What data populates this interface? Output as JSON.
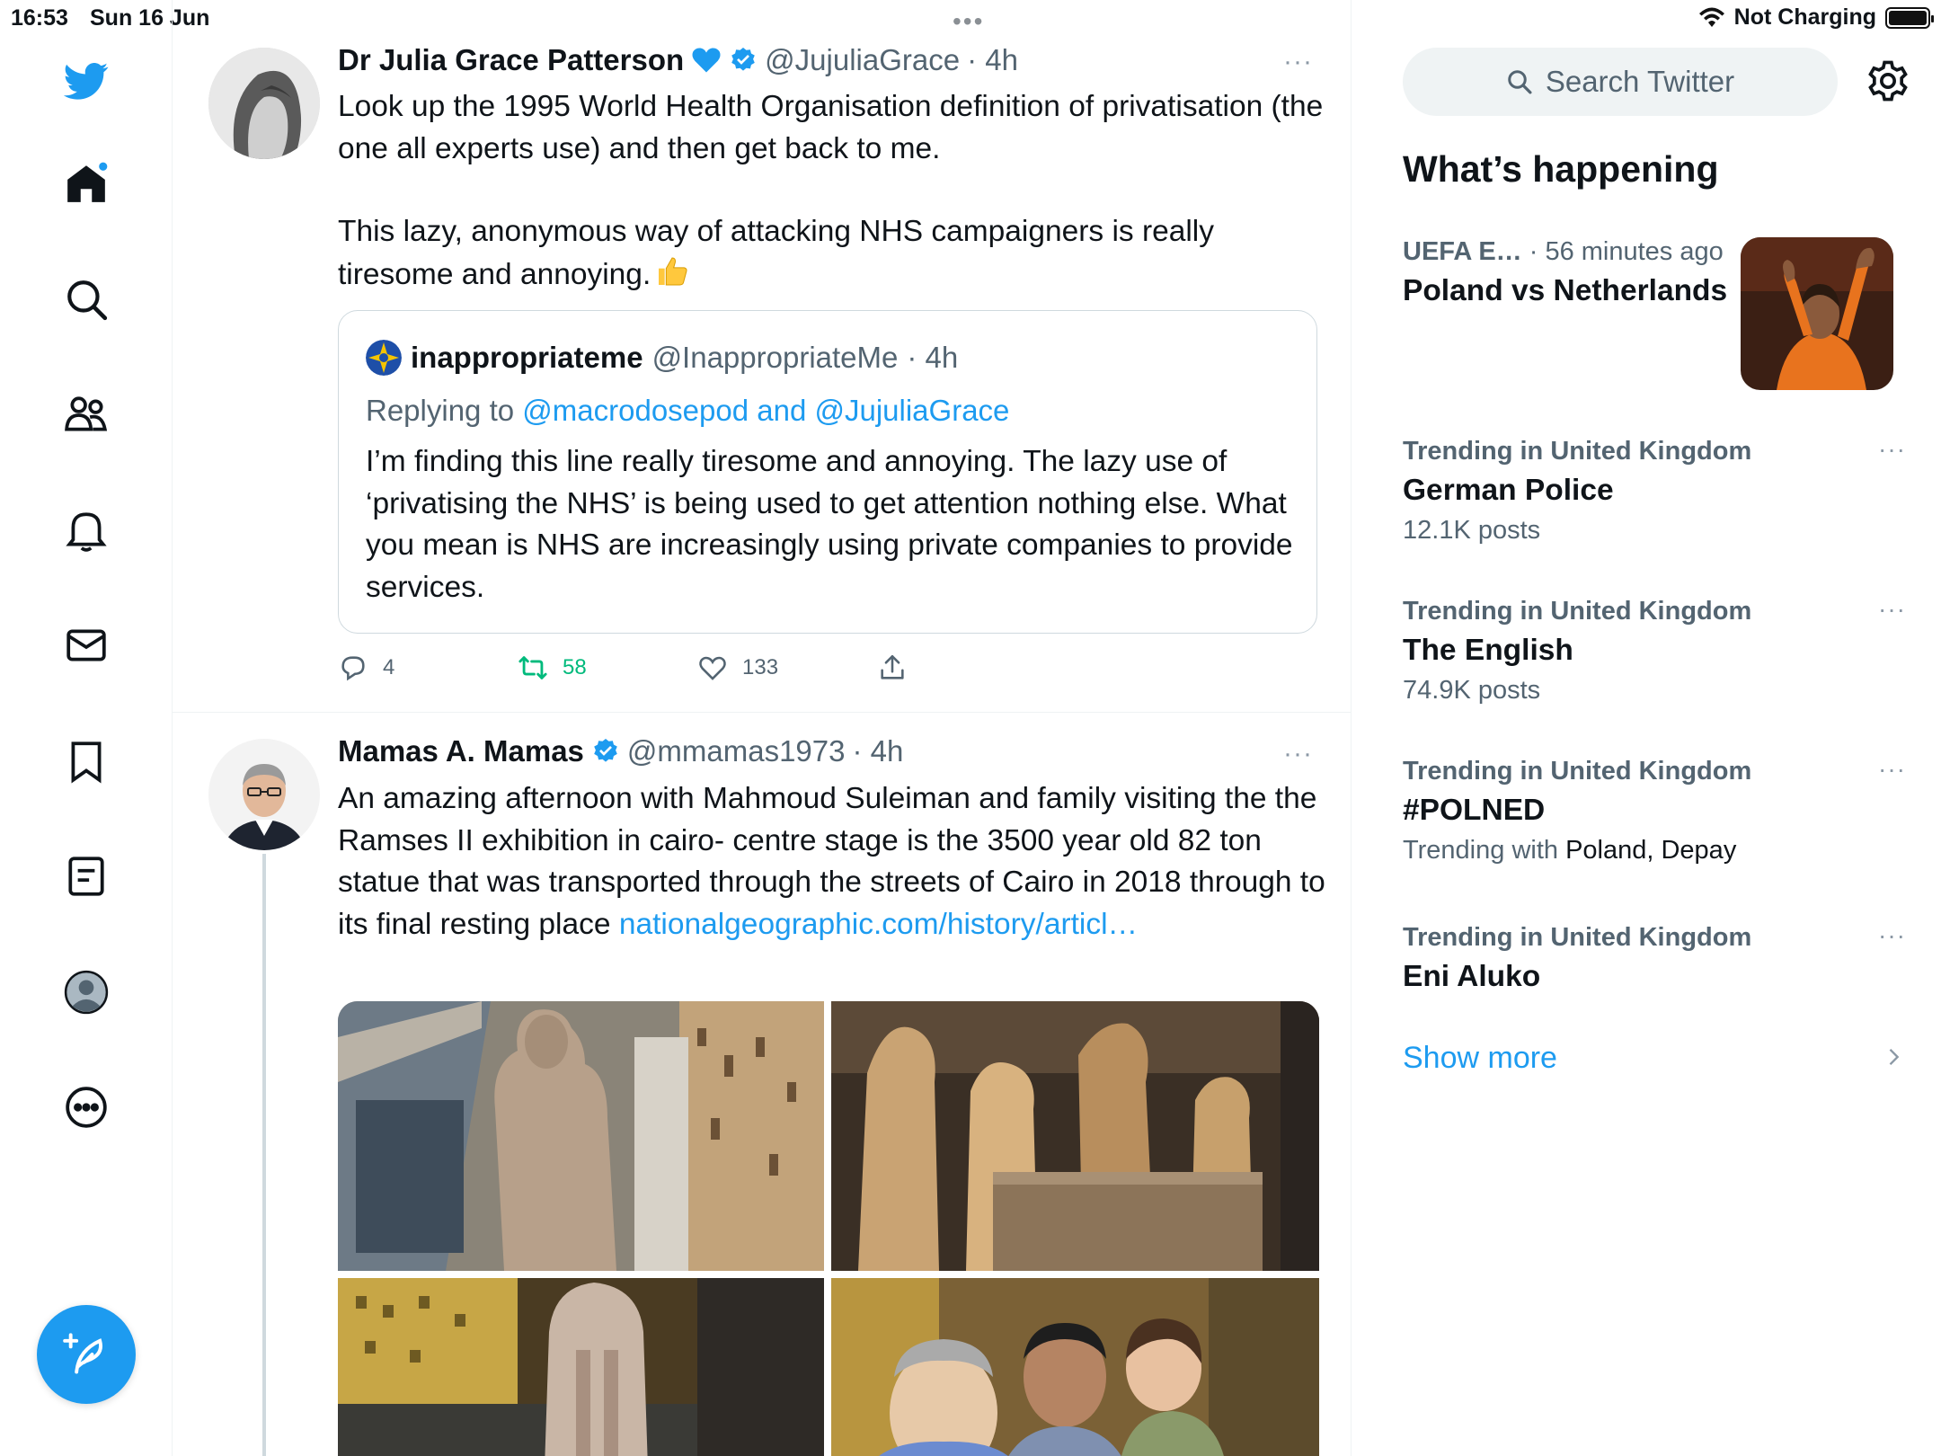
{
  "status_bar": {
    "time": "16:53",
    "date": "Sun 16 Jun",
    "center_dots": "•••",
    "charging": "Not Charging",
    "battery_percent": 100
  },
  "nav": {
    "items": [
      "twitter-logo",
      "home",
      "explore",
      "communities",
      "notifications",
      "messages",
      "bookmarks",
      "lists",
      "profile",
      "more"
    ],
    "home_has_notification_dot": true,
    "accent_color": "#1d9bf0"
  },
  "tweets": [
    {
      "name": "Dr Julia Grace Patterson",
      "verified": true,
      "handle": "@JujuliaGrace",
      "time": "· 4h",
      "more": "···",
      "text_p1": "Look up the 1995 World Health Organisation definition of privatisation (the one all experts use) and then get back to me.",
      "text_p2": "This lazy, anonymous way of attacking NHS campaigners is really tiresome and annoying.",
      "quote": {
        "name": "inappropriateme",
        "handle": "@InappropriateMe",
        "time": "· 4h",
        "replying_prefix": "Replying to",
        "replying_to": "@macrodosepod and @JujuliaGrace",
        "text": "I’m finding this line really tiresome and annoying.  The lazy use of ‘privatising the NHS’ is being used to get attention nothing else.  What you mean is NHS are increasingly using private companies to provide services."
      },
      "actions": {
        "replies": "4",
        "retweets": "58",
        "likes": "133"
      }
    },
    {
      "name": "Mamas A. Mamas",
      "verified": true,
      "handle": "@mmamas1973",
      "time": "· 4h",
      "more": "···",
      "text": "An amazing afternoon with Mahmoud Suleiman and family visiting the the Ramses II exhibition in cairo- centre stage is the 3500 year old 82 ton statue that was transported through the streets of Cairo in 2018 through to its final resting place ",
      "link": "nationalgeographic.com/history/articl…"
    }
  ],
  "sidebar": {
    "search_placeholder": "Search Twitter",
    "whats_happening": "What’s happening",
    "trends": [
      {
        "meta_a": "UEFA E…",
        "meta_b": " · 56 minutes ago",
        "title": "Poland vs Netherlands"
      },
      {
        "meta": "Trending in United Kingdom",
        "title": "German Police",
        "sub": "12.1K posts"
      },
      {
        "meta": "Trending in United Kingdom",
        "title": "The English",
        "sub": "74.9K posts"
      },
      {
        "meta": "Trending in United Kingdom",
        "title": "#POLNED",
        "sub_prefix": "Trending with",
        "sub_with": " Poland, Depay"
      },
      {
        "meta": "Trending in United Kingdom",
        "title": "Eni Aluko"
      }
    ],
    "trend_more": "···",
    "show_more": "Show more"
  }
}
